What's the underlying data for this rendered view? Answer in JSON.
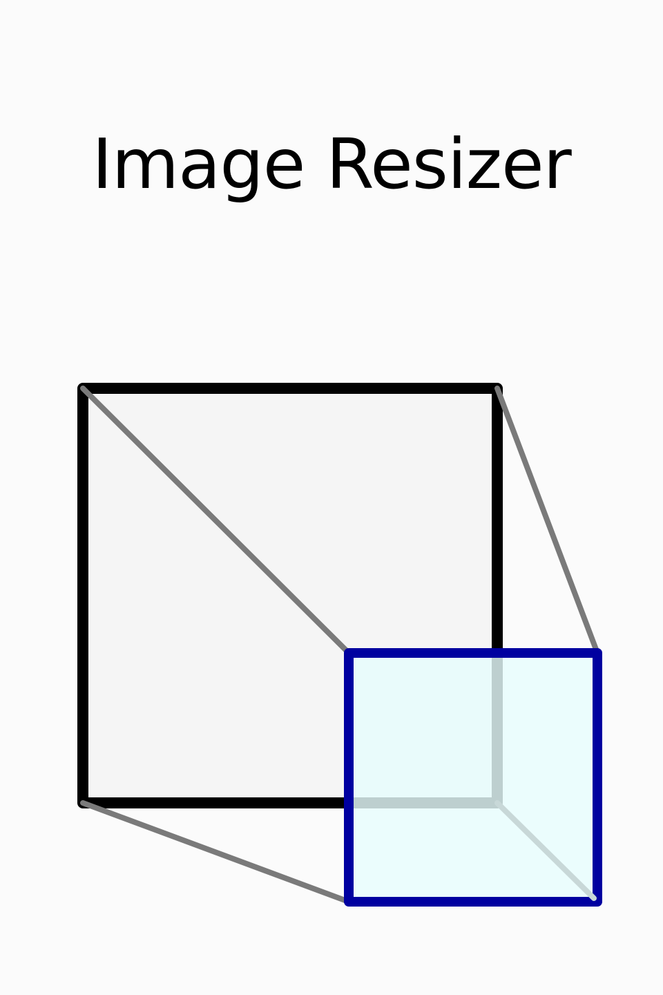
{
  "app": {
    "title": "Image Resizer"
  },
  "icon": {
    "name": "resize-icon",
    "colors": {
      "background": "#fbfbfb",
      "original_fill": "#f5f5f5",
      "original_stroke": "#000000",
      "projection_lines": "#7a7a7a",
      "resized_fill": "#e6fcfc",
      "resized_stroke": "#0000a0"
    }
  }
}
